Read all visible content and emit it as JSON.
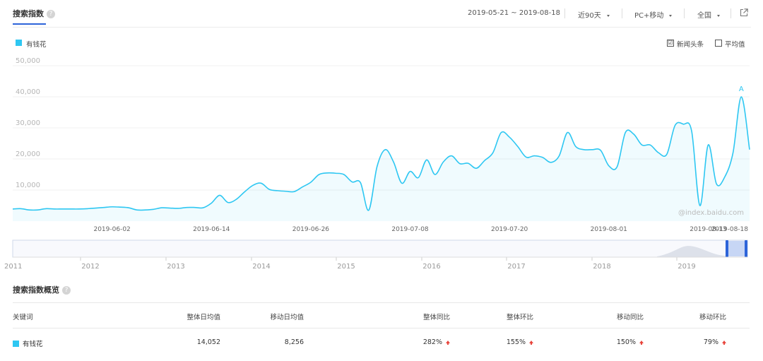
{
  "header": {
    "title": "搜索指数",
    "help_glyph": "?",
    "date_range": "2019-05-21 ~ 2019-08-18",
    "period": "近90天",
    "device": "PC+移动",
    "region": "全国"
  },
  "legend": {
    "keyword": "有钱花",
    "color": "#2ec7f2"
  },
  "options": {
    "news_label": "新闻头条",
    "news_checked": true,
    "news_mark": "☑",
    "avg_label": "平均值",
    "avg_checked": false
  },
  "chart_data": {
    "type": "area",
    "series": [
      {
        "name": "有钱花",
        "color": "#2ec7f2",
        "x": [
          "2019-05-21",
          "2019-05-22",
          "2019-05-23",
          "2019-05-24",
          "2019-05-25",
          "2019-05-26",
          "2019-05-27",
          "2019-05-28",
          "2019-05-29",
          "2019-05-30",
          "2019-05-31",
          "2019-06-01",
          "2019-06-02",
          "2019-06-03",
          "2019-06-04",
          "2019-06-05",
          "2019-06-06",
          "2019-06-07",
          "2019-06-08",
          "2019-06-09",
          "2019-06-10",
          "2019-06-11",
          "2019-06-12",
          "2019-06-13",
          "2019-06-14",
          "2019-06-15",
          "2019-06-16",
          "2019-06-17",
          "2019-06-18",
          "2019-06-19",
          "2019-06-20",
          "2019-06-21",
          "2019-06-22",
          "2019-06-23",
          "2019-06-24",
          "2019-06-25",
          "2019-06-26",
          "2019-06-27",
          "2019-06-28",
          "2019-06-29",
          "2019-06-30",
          "2019-07-01",
          "2019-07-02",
          "2019-07-03",
          "2019-07-04",
          "2019-07-05",
          "2019-07-06",
          "2019-07-07",
          "2019-07-08",
          "2019-07-09",
          "2019-07-10",
          "2019-07-11",
          "2019-07-12",
          "2019-07-13",
          "2019-07-14",
          "2019-07-15",
          "2019-07-16",
          "2019-07-17",
          "2019-07-18",
          "2019-07-19",
          "2019-07-20",
          "2019-07-21",
          "2019-07-22",
          "2019-07-23",
          "2019-07-24",
          "2019-07-25",
          "2019-07-26",
          "2019-07-27",
          "2019-07-28",
          "2019-07-29",
          "2019-07-30",
          "2019-07-31",
          "2019-08-01",
          "2019-08-02",
          "2019-08-03",
          "2019-08-04",
          "2019-08-05",
          "2019-08-06",
          "2019-08-07",
          "2019-08-08",
          "2019-08-09",
          "2019-08-10",
          "2019-08-11",
          "2019-08-12",
          "2019-08-13",
          "2019-08-14",
          "2019-08-15",
          "2019-08-16",
          "2019-08-17",
          "2019-08-18"
        ],
        "values": [
          3900,
          4000,
          3600,
          3600,
          4000,
          3900,
          3900,
          3900,
          3900,
          4000,
          4200,
          4400,
          4600,
          4500,
          4300,
          3600,
          3600,
          3800,
          4300,
          4200,
          4100,
          4400,
          4400,
          4300,
          5800,
          8300,
          6000,
          7000,
          9400,
          11500,
          12200,
          10200,
          9800,
          9600,
          9500,
          11000,
          12500,
          15000,
          15500,
          15400,
          15000,
          12600,
          12400,
          3500,
          17500,
          23000,
          19000,
          12200,
          16000,
          14000,
          19700,
          15000,
          19000,
          21000,
          18500,
          18600,
          17000,
          19500,
          22000,
          28500,
          27000,
          24000,
          20600,
          21000,
          20500,
          18900,
          21000,
          28500,
          24000,
          23000,
          23000,
          22800,
          17800,
          17500,
          28500,
          28000,
          24500,
          24500,
          22000,
          21500,
          30800,
          31200,
          29000,
          5000,
          24500,
          12000,
          14200,
          22000,
          40000,
          23000
        ],
        "annotation": {
          "x": "2019-08-17",
          "label": "A"
        }
      }
    ],
    "x_tick_labels": [
      "2019-06-02",
      "2019-06-14",
      "2019-06-26",
      "2019-07-08",
      "2019-07-20",
      "2019-08-01",
      "2019-08-13",
      "2019-08-18"
    ],
    "y_tick_labels": [
      "10,000",
      "20,000",
      "30,000",
      "40,000",
      "50,000"
    ],
    "y_ticks": [
      10000,
      20000,
      30000,
      40000,
      50000
    ],
    "ylim": [
      0,
      50000
    ],
    "grid": true,
    "watermark": "@index.baidu.com",
    "navigator": {
      "year_labels": [
        "2011",
        "2012",
        "2013",
        "2014",
        "2015",
        "2016",
        "2017",
        "2018",
        "2019"
      ],
      "selection": [
        "2019-05-21",
        "2019-08-18"
      ]
    }
  },
  "overview": {
    "title": "搜索指数概览",
    "help_glyph": "?",
    "columns": [
      "关键词",
      "整体日均值",
      "移动日均值",
      "整体同比",
      "整体环比",
      "移动同比",
      "移动环比"
    ],
    "rows": [
      {
        "keyword": "有钱花",
        "color": "#2ec7f2",
        "overall_daily_avg": "14,052",
        "mobile_daily_avg": "8,256",
        "overall_yoy": "282%",
        "overall_mom": "155%",
        "mobile_yoy": "150%",
        "mobile_mom": "79%"
      }
    ]
  }
}
